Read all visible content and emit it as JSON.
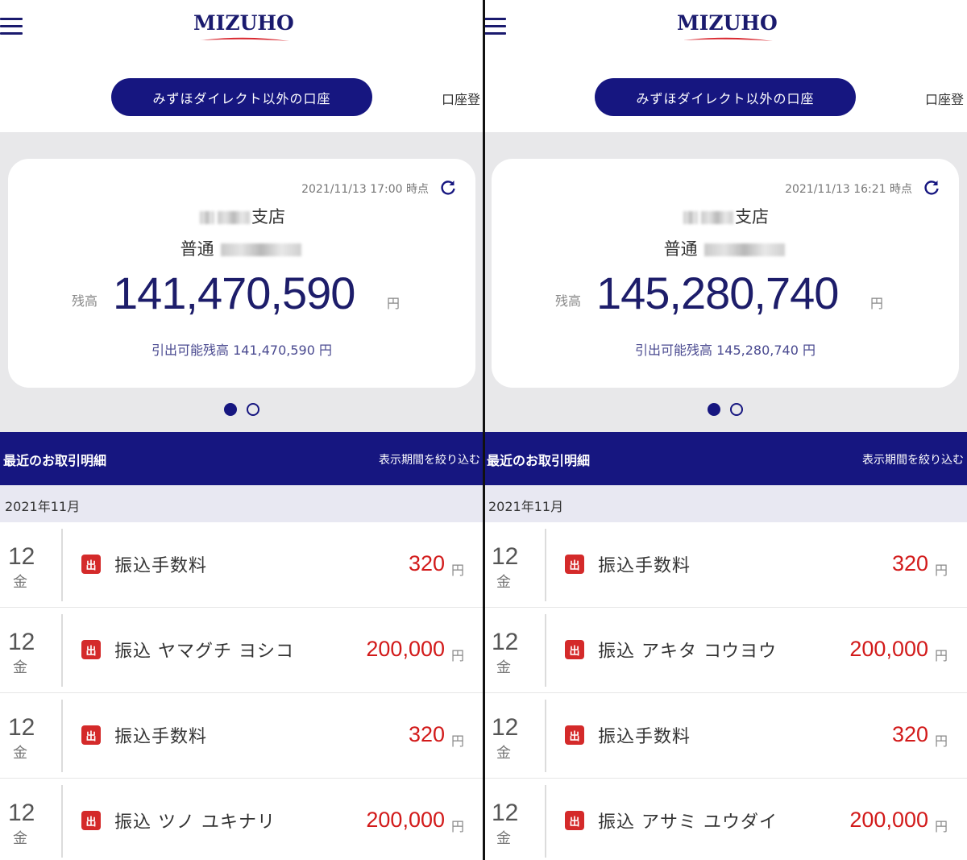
{
  "logo_text": "MIZUHO",
  "tab_label": "みずほダイレクト以外の口座",
  "tab_right_label": "口座登",
  "balance_label": "残高",
  "yen": "円",
  "transactions_title": "最近のお取引明細",
  "filter_label": "表示期間を絞り込む",
  "month": "2021年11月",
  "out_badge": "出",
  "colors": {
    "primary": "#161680",
    "withdrawal": "#d21a1a",
    "badge": "#d42a2a"
  },
  "icons": [
    "menu-icon",
    "refresh-icon",
    "mizuho-logo"
  ],
  "panels": [
    {
      "timestamp": "2021/11/13 17:00 時点",
      "branch_suffix": "支店",
      "account_type": "普通",
      "balance": "141,470,590",
      "available": "引出可能残高 141,470,590 円",
      "transactions": [
        {
          "day": "12",
          "dow": "金",
          "desc": "振込手数料",
          "amount": "320"
        },
        {
          "day": "12",
          "dow": "金",
          "desc": "振込 ヤマグチ ヨシコ",
          "amount": "200,000"
        },
        {
          "day": "12",
          "dow": "金",
          "desc": "振込手数料",
          "amount": "320"
        },
        {
          "day": "12",
          "dow": "金",
          "desc": "振込 ツノ ユキナリ",
          "amount": "200,000"
        }
      ]
    },
    {
      "timestamp": "2021/11/13 16:21 時点",
      "branch_suffix": "支店",
      "account_type": "普通",
      "balance": "145,280,740",
      "available": "引出可能残高 145,280,740 円",
      "transactions": [
        {
          "day": "12",
          "dow": "金",
          "desc": "振込手数料",
          "amount": "320"
        },
        {
          "day": "12",
          "dow": "金",
          "desc": "振込 アキタ コウヨウ",
          "amount": "200,000"
        },
        {
          "day": "12",
          "dow": "金",
          "desc": "振込手数料",
          "amount": "320"
        },
        {
          "day": "12",
          "dow": "金",
          "desc": "振込 アサミ ユウダイ",
          "amount": "200,000"
        }
      ]
    }
  ]
}
